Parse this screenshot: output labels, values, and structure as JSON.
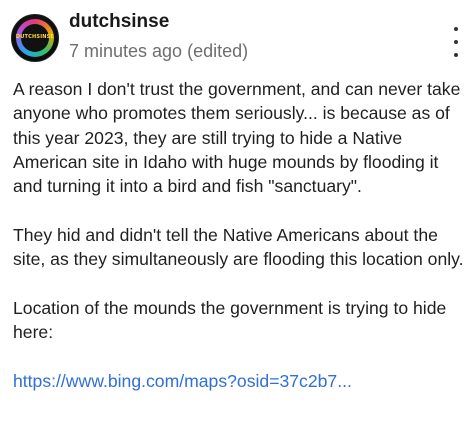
{
  "post": {
    "author": {
      "username": "dutchsinse",
      "avatar_text": "DUTCHSINSE",
      "avatar_icon": "avatar-logo-icon"
    },
    "timestamp": "7 minutes ago (edited)",
    "more_menu_icon": "more-vertical-icon",
    "paragraphs": [
      "A reason I don't trust the government, and can never take anyone who promotes them seriously... is because as of this year 2023, they are still trying to hide a Native American site in Idaho with huge mounds by flooding it and turning it into a bird and fish \"sanctuary\".",
      "They hid and didn't tell the Native Americans about the site, as they simultaneously are flooding this location only.",
      "Location of the mounds the government is trying to hide here:"
    ],
    "link": {
      "text": "https://www.bing.com/maps?osid=37c2b7...",
      "color": "#2f6fd8"
    }
  }
}
